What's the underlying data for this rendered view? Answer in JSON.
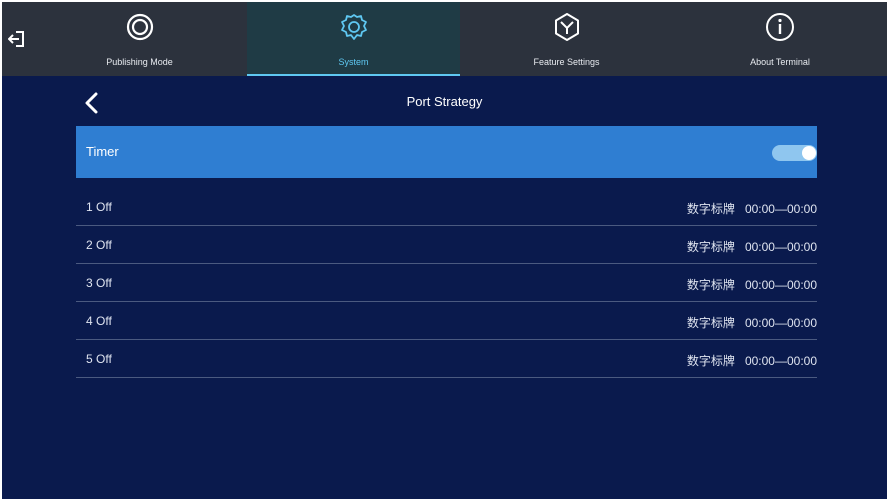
{
  "nav": {
    "tabs": [
      {
        "label": "Publishing Mode",
        "icon": "publishing-mode-icon"
      },
      {
        "label": "System",
        "icon": "gear-icon",
        "active": true
      },
      {
        "label": "Feature Settings",
        "icon": "feature-settings-icon"
      },
      {
        "label": "About Terminal",
        "icon": "info-icon"
      }
    ]
  },
  "page": {
    "title": "Port Strategy"
  },
  "timer": {
    "label": "Timer",
    "enabled": true
  },
  "ports": [
    {
      "name": "1 Off",
      "device": "数字标牌",
      "time": "00:00—00:00"
    },
    {
      "name": "2 Off",
      "device": "数字标牌",
      "time": "00:00—00:00"
    },
    {
      "name": "3 Off",
      "device": "数字标牌",
      "time": "00:00—00:00"
    },
    {
      "name": "4 Off",
      "device": "数字标牌",
      "time": "00:00—00:00"
    },
    {
      "name": "5 Off",
      "device": "数字标牌",
      "time": "00:00—00:00"
    }
  ],
  "colors": {
    "background": "#0a1a4d",
    "topbar": "#2c323d",
    "accent": "#5fc8f2",
    "highlight_row": "#2f7ed2"
  }
}
